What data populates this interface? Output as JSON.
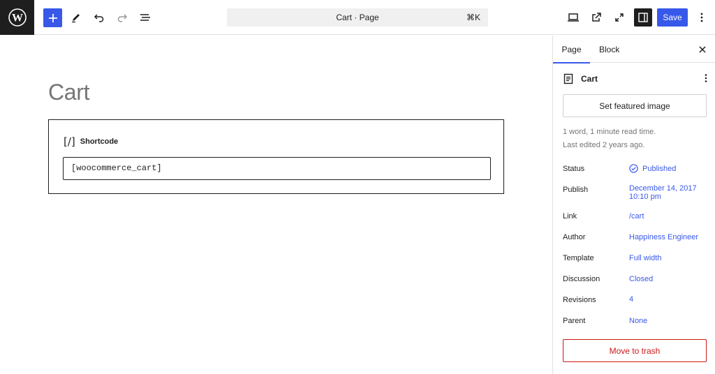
{
  "header": {
    "logo_icon": "wordpress-logo-icon",
    "tools": [
      "add-block-icon",
      "pencil-icon",
      "undo-icon",
      "redo-icon",
      "list-view-icon"
    ],
    "command_bar": {
      "title": "Cart · Page",
      "shortcut": "⌘K"
    },
    "view_tools": [
      "desktop-preview-icon",
      "external-link-icon",
      "fullscreen-icon",
      "sidebar-toggle-icon"
    ],
    "save_label": "Save",
    "accent": "#3858e9"
  },
  "editor": {
    "page_title": "Cart",
    "block": {
      "label": "Shortcode",
      "icon_glyph": "[/]",
      "value": "[woocommerce_cart]"
    }
  },
  "sidebar": {
    "tabs": {
      "page": "Page",
      "block": "Block"
    },
    "document": {
      "title": "Cart"
    },
    "featured_image_label": "Set featured image",
    "meta": {
      "reading": "1 word, 1 minute read time.",
      "edited": "Last edited 2 years ago."
    },
    "rows": {
      "status": {
        "label": "Status",
        "value": "Published"
      },
      "publish": {
        "label": "Publish",
        "value_date": "December 14, 2017",
        "value_time": "10:10 pm"
      },
      "link": {
        "label": "Link",
        "value": "/cart"
      },
      "author": {
        "label": "Author",
        "value": "Happiness Engineer"
      },
      "template": {
        "label": "Template",
        "value": "Full width"
      },
      "discussion": {
        "label": "Discussion",
        "value": "Closed"
      },
      "revisions": {
        "label": "Revisions",
        "value": "4"
      },
      "parent": {
        "label": "Parent",
        "value": "None"
      }
    },
    "trash_label": "Move to trash",
    "danger_color": "#cc1818"
  }
}
